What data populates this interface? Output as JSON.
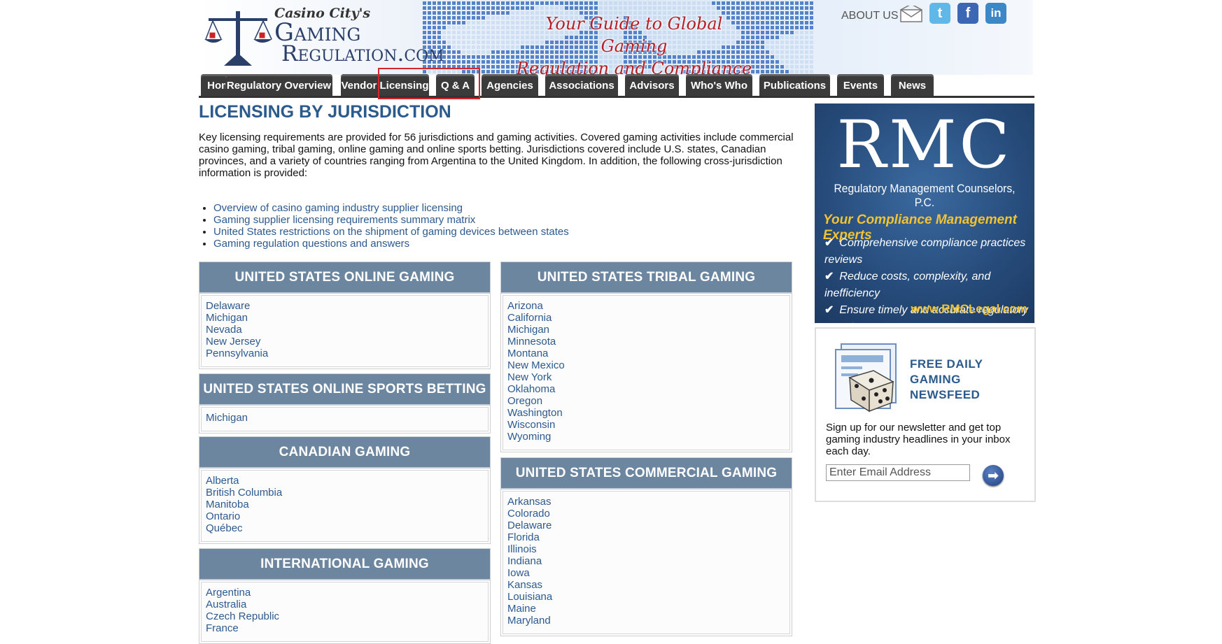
{
  "header": {
    "logo_small": "Casino City's",
    "logo_line1": "Gaming",
    "logo_line2": "Regulation.com",
    "tagline_line1": "Your Guide to Global Gaming",
    "tagline_line2": "Regulation and Compliance",
    "about_label": "ABOUT US",
    "icons": [
      "mail-icon",
      "twitter-icon",
      "facebook-icon",
      "linkedin-icon"
    ],
    "twitter_glyph": "t",
    "facebook_glyph": "f",
    "linkedin_glyph": "in"
  },
  "nav": {
    "tabs": [
      "Home",
      "Regulatory Overview",
      "Vendor Licensing",
      "Q & A",
      "Agencies",
      "Associations",
      "Advisors",
      "Who's Who",
      "Publications",
      "Events",
      "News"
    ],
    "highlighted": "Vendor Licensing",
    "highlight_color": "#d4262b"
  },
  "main": {
    "title": "LICENSING BY JURISDICTION",
    "intro": "Key licensing requirements are provided for 56 jurisdictions and gaming activities. Covered gaming activities include commercial casino gaming, tribal gaming, online gaming and online sports betting. Jurisdictions covered include U.S. states, Canadian provinces, and a variety of countries ranging from Argentina to the United Kingdom. In addition, the following cross-jurisdiction information is provided:",
    "links": [
      "Overview of casino gaming industry supplier licensing",
      "Gaming supplier licensing requirements summary matrix",
      "United States restrictions on the shipment of gaming devices between states",
      "Gaming regulation questions and answers"
    ],
    "boxes": {
      "us_online": {
        "title": "UNITED STATES ONLINE GAMING",
        "items": [
          "Delaware",
          "Michigan",
          "Nevada",
          "New Jersey",
          "Pennsylvania"
        ]
      },
      "us_sports": {
        "title": "UNITED STATES ONLINE SPORTS BETTING",
        "items": [
          "Michigan"
        ]
      },
      "canada": {
        "title": "CANADIAN GAMING",
        "items": [
          "Alberta",
          "British Columbia",
          "Manitoba",
          "Ontario",
          "Québec"
        ]
      },
      "international": {
        "title": "INTERNATIONAL GAMING",
        "items": [
          "Argentina",
          "Australia",
          "Czech Republic",
          "France"
        ]
      },
      "us_tribal": {
        "title": "UNITED STATES TRIBAL GAMING",
        "items": [
          "Arizona",
          "California",
          "Michigan",
          "Minnesota",
          "Montana",
          "New Mexico",
          "New York",
          "Oklahoma",
          "Oregon",
          "Washington",
          "Wisconsin",
          "Wyoming"
        ]
      },
      "us_commercial": {
        "title": "UNITED STATES COMMERCIAL GAMING",
        "items": [
          "Arkansas",
          "Colorado",
          "Delaware",
          "Florida",
          "Illinois",
          "Indiana",
          "Iowa",
          "Kansas",
          "Louisiana",
          "Maine",
          "Maryland"
        ]
      }
    }
  },
  "sidebar": {
    "ad": {
      "brand": "RMC",
      "subtitle": "Regulatory Management Counselors, P.C.",
      "tagline": "Your Compliance Management Experts",
      "bullets": [
        "Comprehensive compliance practices reviews",
        "Reduce costs, complexity, and inefficiency",
        "Ensure timely and accurate regulatory reports"
      ],
      "url": "www.RMCLegal.com"
    },
    "newsfeed": {
      "title": "FREE DAILY GAMING NEWSFEED",
      "text": "Sign up for our newsletter and get top gaming industry headlines in your inbox each day.",
      "email_placeholder": "Enter Email Address",
      "submit_glyph": "➡"
    }
  }
}
